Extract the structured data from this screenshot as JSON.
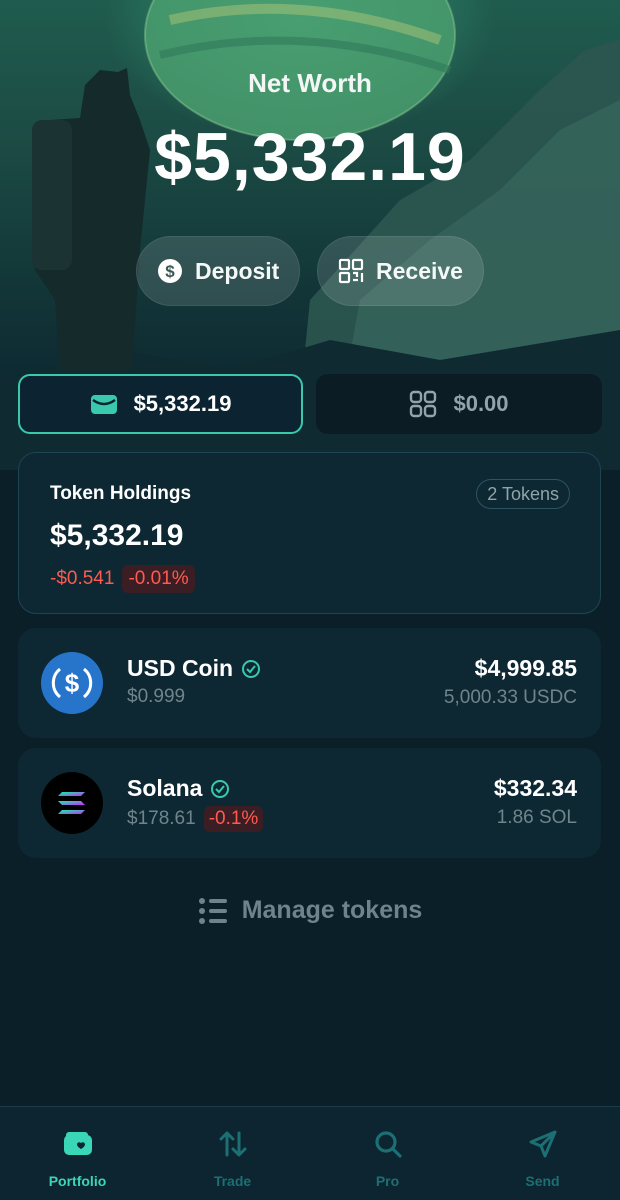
{
  "header": {
    "net_worth_label": "Net Worth",
    "net_worth_value": "$5,332.19"
  },
  "actions": {
    "deposit_label": "Deposit",
    "receive_label": "Receive"
  },
  "segments": {
    "tokens_value": "$5,332.19",
    "collectibles_value": "$0.00"
  },
  "holdings": {
    "title": "Token Holdings",
    "count_badge": "2 Tokens",
    "value": "$5,332.19",
    "change": "-$0.541",
    "change_pct": "-0.01%"
  },
  "tokens": [
    {
      "name": "USD Coin",
      "price": "$0.999",
      "usd_value": "$4,999.85",
      "amount": "5,000.33 USDC",
      "icon": "usdc-logo-icon"
    },
    {
      "name": "Solana",
      "price": "$178.61",
      "change_pct": "-0.1%",
      "usd_value": "$332.34",
      "amount": "1.86 SOL",
      "icon": "solana-logo-icon"
    }
  ],
  "manage_label": "Manage tokens",
  "nav": {
    "portfolio": "Portfolio",
    "trade": "Trade",
    "pro": "Pro",
    "send": "Send"
  },
  "colors": {
    "accent": "#39c9ad",
    "negative": "#ff5a50",
    "background": "#0b1f28",
    "usdc_blue": "#2775ca"
  }
}
